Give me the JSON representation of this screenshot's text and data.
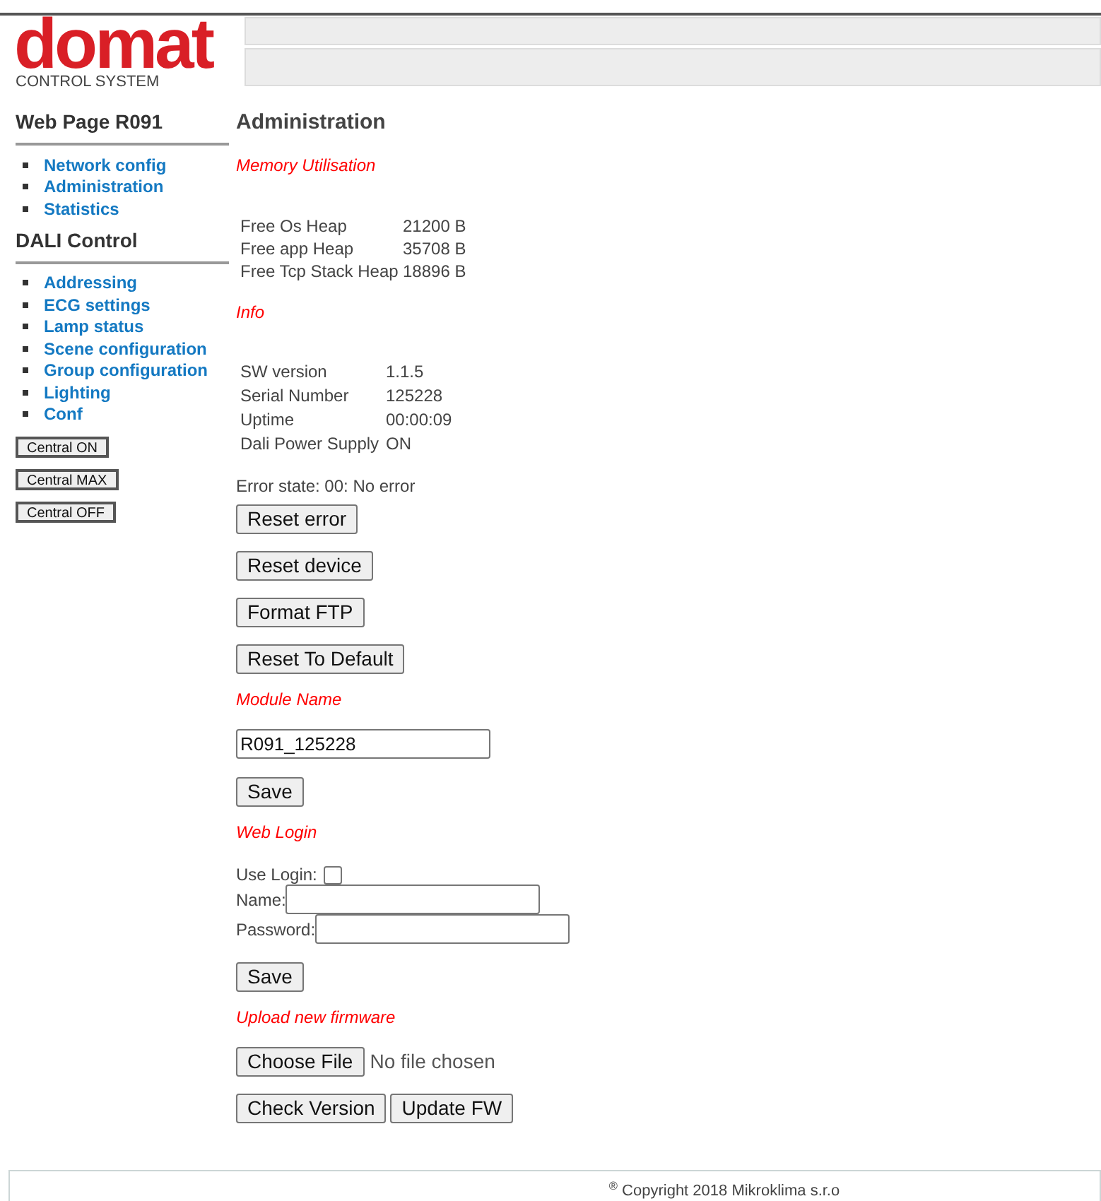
{
  "logo": {
    "name": "domat",
    "tagline": "CONTROL SYSTEM"
  },
  "sidebar": {
    "sections": [
      {
        "title": "Web Page R091",
        "items": [
          "Network config",
          "Administration",
          "Statistics"
        ]
      },
      {
        "title": "DALI Control",
        "items": [
          "Addressing",
          "ECG settings",
          "Lamp status",
          "Scene configuration",
          "Group configuration",
          "Lighting",
          "Conf"
        ]
      }
    ],
    "buttons": [
      "Central ON",
      "Central MAX",
      "Central OFF"
    ]
  },
  "main": {
    "title": "Administration",
    "memory": {
      "heading": "Memory Utilisation",
      "rows": [
        [
          "Free Os Heap",
          "21200 B"
        ],
        [
          "Free app Heap",
          "35708 B"
        ],
        [
          "Free Tcp Stack Heap",
          "18896 B"
        ]
      ]
    },
    "info": {
      "heading": "Info",
      "rows": [
        [
          "SW version",
          "1.1.5"
        ],
        [
          "Serial Number",
          "125228"
        ],
        [
          "Uptime",
          "00:00:09"
        ],
        [
          "Dali Power Supply",
          "ON"
        ]
      ]
    },
    "error_state": "Error state: 00: No error",
    "actions": [
      "Reset error",
      "Reset device",
      "Format FTP",
      "Reset To Default"
    ],
    "module": {
      "heading": "Module Name",
      "value": "R091_125228",
      "save": "Save"
    },
    "login": {
      "heading": "Web Login",
      "use_label": "Use Login:",
      "checked": false,
      "name_label": "Name:",
      "password_label": "Password:",
      "save": "Save"
    },
    "firmware": {
      "heading": "Upload new firmware",
      "choose": "Choose File",
      "status": "No file chosen",
      "check": "Check Version",
      "update": "Update FW"
    }
  },
  "footer": "$^{®}$ Copyright 2018 Mikroklima s.r.o"
}
